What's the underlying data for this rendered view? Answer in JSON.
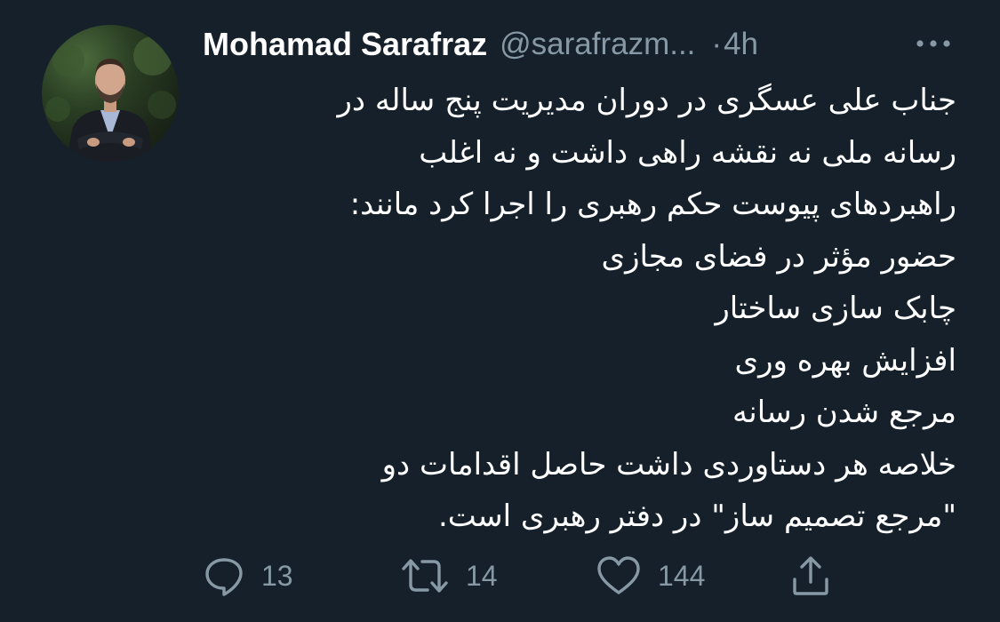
{
  "tweet": {
    "author_name": "Mohamad Sarafraz",
    "handle": "@sarafrazm...",
    "separator": "·",
    "time": "4h",
    "lines": [
      "جناب علی عسگری در دوران مدیریت پنج ساله در",
      "رسانه ملی نه نقشه راهی داشت و نه اغلب",
      "راهبردهای پیوست حکم رهبری را اجرا کرد مانند:",
      "حضور مؤثر در فضای مجازی",
      "چابک سازی ساختار",
      "افزایش بهره وری",
      "مرجع شدن رسانه",
      "خلاصه هر دستاوردی داشت حاصل اقدامات دو",
      "\"مرجع تصمیم ساز\" در دفتر رهبری است."
    ]
  },
  "actions": {
    "reply_count": "13",
    "retweet_count": "14",
    "like_count": "144"
  },
  "icons": {
    "more": "more-horizontal-icon",
    "reply": "reply-icon",
    "retweet": "retweet-icon",
    "like": "heart-icon",
    "share": "share-icon"
  },
  "colors": {
    "background": "#15202b",
    "text": "#ffffff",
    "secondary_text": "#8899a6"
  }
}
